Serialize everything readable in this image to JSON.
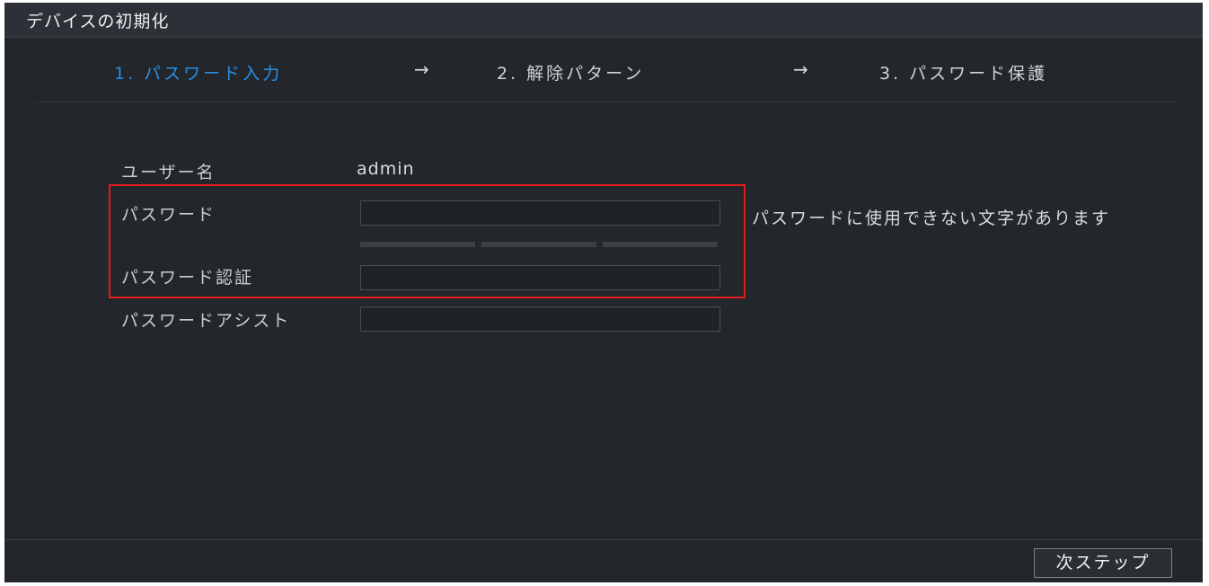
{
  "window": {
    "title": "デバイスの初期化"
  },
  "steps": [
    {
      "label": "1. パスワード入力",
      "active": true
    },
    {
      "label": "2. 解除パターン",
      "active": false
    },
    {
      "label": "3. パスワード保護",
      "active": false
    }
  ],
  "arrow_icon": "→",
  "form": {
    "username_label": "ユーザー名",
    "username_value": "admin",
    "password_label": "パスワード",
    "password_value": "",
    "confirm_label": "パスワード認証",
    "confirm_value": "",
    "hint_label": "パスワードアシスト",
    "hint_value": "",
    "password_strength_segments": 3
  },
  "error_message": "パスワードに使用できない文字があります",
  "footer": {
    "next_label": "次ステップ"
  },
  "colors": {
    "background": "#23262b",
    "active_step": "#2a8ee3",
    "highlight_border": "#e41b1b"
  }
}
